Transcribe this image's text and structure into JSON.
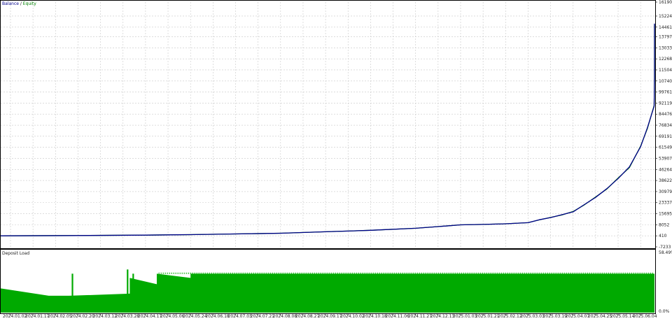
{
  "chart_data": [
    {
      "type": "line",
      "legend": {
        "balance_label": "Balance",
        "separator": " / ",
        "equity_label": "Equity",
        "placement": "top-left"
      },
      "grid": true,
      "y_ticks": [
        161901,
        152248,
        144616,
        137973,
        130331,
        122688,
        115046,
        107404,
        99761,
        92119,
        84476,
        76834,
        69191,
        61549,
        53907,
        46264,
        38622,
        30979,
        23337,
        15695,
        8052,
        410,
        -7233
      ],
      "ylim": [
        -7233,
        161901
      ],
      "x_ticks": [
        "2024.01.02",
        "2024.01.17",
        "2024.02.05",
        "2024.02.20",
        "2024.03.12",
        "2024.03.28",
        "2024.04.17",
        "2024.05.06",
        "2024.05.24",
        "2024.06.18",
        "2024.07.03",
        "2024.07.21",
        "2024.08.08",
        "2024.08.27",
        "2024.09.17",
        "2024.10.02",
        "2024.10.18",
        "2024.11.06",
        "2024.11.27",
        "2024.12.13",
        "2025.01.03",
        "2025.01.21",
        "2025.02.12",
        "2025.03.03",
        "2025.03.19",
        "2025.04.07",
        "2025.04.25",
        "2025.05.14",
        "2025.06.04"
      ],
      "series": [
        {
          "name": "Balance",
          "color": "#00008b",
          "points": [
            [
              0,
              410
            ],
            [
              3,
              600
            ],
            [
              6,
              900
            ],
            [
              8,
              1200
            ],
            [
              10,
              1700
            ],
            [
              12,
              2200
            ],
            [
              14,
              3200
            ],
            [
              16,
              4200
            ],
            [
              18,
              5600
            ],
            [
              19,
              6800
            ],
            [
              20,
              8000
            ],
            [
              21,
              8300
            ],
            [
              22,
              8700
            ],
            [
              23,
              9500
            ],
            [
              23.5,
              11500
            ],
            [
              24,
              13000
            ],
            [
              24.5,
              15000
            ],
            [
              25,
              17000
            ],
            [
              25.5,
              22000
            ],
            [
              26,
              27000
            ],
            [
              26.5,
              33000
            ],
            [
              27,
              40000
            ],
            [
              27.5,
              48000
            ],
            [
              28,
              62000
            ],
            [
              28.3,
              75000
            ],
            [
              28.6,
              90000
            ],
            [
              28.9,
              110000
            ],
            [
              29.2,
              130000
            ],
            [
              29.4,
              147000
            ]
          ]
        },
        {
          "name": "Equity",
          "color": "#008000",
          "points": [
            [
              0,
              410
            ],
            [
              3,
              600
            ],
            [
              6,
              900
            ],
            [
              8,
              1200
            ],
            [
              10,
              1700
            ],
            [
              12,
              2200
            ],
            [
              14,
              3200
            ],
            [
              16,
              4200
            ],
            [
              18,
              5600
            ],
            [
              19,
              6800
            ],
            [
              20,
              8000
            ],
            [
              21,
              8300
            ],
            [
              22,
              8700
            ],
            [
              23,
              9500
            ],
            [
              23.5,
              11400
            ],
            [
              24,
              13100
            ],
            [
              24.5,
              14800
            ],
            [
              25,
              17200
            ],
            [
              25.5,
              21800
            ],
            [
              26,
              27200
            ],
            [
              26.5,
              32800
            ],
            [
              27,
              40300
            ],
            [
              27.5,
              47500
            ],
            [
              28,
              62400
            ],
            [
              28.3,
              74500
            ],
            [
              28.6,
              90500
            ],
            [
              28.9,
              109000
            ],
            [
              29.2,
              131000
            ],
            [
              29.4,
              146500
            ]
          ]
        }
      ]
    },
    {
      "type": "area",
      "title": "Deposit Load",
      "y_ticks": [
        "58.49%",
        "0.0%"
      ],
      "ylim": [
        0,
        58.49
      ],
      "color": "#00aa00",
      "segments": [
        {
          "from": 0,
          "to": 1.7,
          "start": 23,
          "end": 16
        },
        {
          "from": 1.7,
          "to": 2.6,
          "start": 16,
          "end": 16
        },
        {
          "from": 2.6,
          "to": 5.3,
          "start": 16,
          "end": 18
        },
        {
          "from": 5.3,
          "to": 6.5,
          "start": 33,
          "end": 27
        },
        {
          "from": 6.5,
          "to": 8.0,
          "start": 37,
          "end": 33
        },
        {
          "from": 8.0,
          "to": 30,
          "start": 37,
          "end": 37
        }
      ],
      "spikes": [
        [
          2.75,
          37
        ],
        [
          5.2,
          41
        ],
        [
          5.45,
          37
        ]
      ]
    }
  ]
}
